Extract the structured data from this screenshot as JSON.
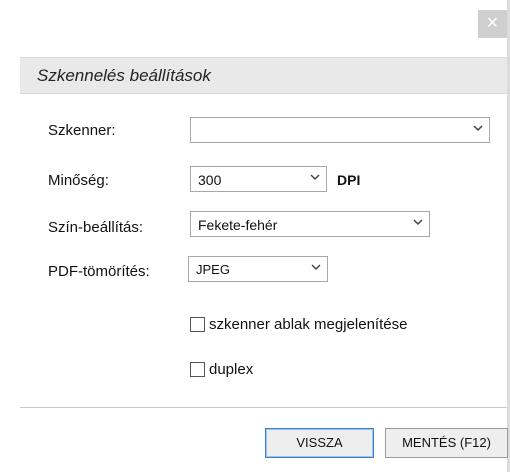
{
  "dialog": {
    "close_icon": "close-icon",
    "close_glyph": "×",
    "section_title": "Szkennelés beállítások"
  },
  "form": {
    "scanner": {
      "label": "Szkenner:",
      "value": ""
    },
    "quality": {
      "label": "Minőség:",
      "value": "300",
      "unit": "DPI"
    },
    "color": {
      "label": "Szín-beállítás:",
      "value": "Fekete-fehér"
    },
    "pdf_compression": {
      "label": "PDF-tömörítés:",
      "value": "JPEG"
    },
    "show_scanner_window": {
      "label": "szkenner ablak megjelenítése",
      "checked": false
    },
    "duplex": {
      "label": "duplex",
      "checked": false
    }
  },
  "buttons": {
    "back_label": "VISSZA",
    "save_label": "MENTÉS (F12)"
  },
  "chevron_glyph": "⌄"
}
